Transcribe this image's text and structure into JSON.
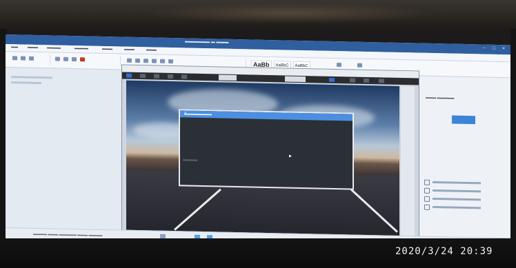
{
  "office": {
    "style_gallery": [
      "AaBb",
      "AaBbC",
      "AaBbC"
    ]
  },
  "timestamp": "2020/3/24  20:39",
  "icons": {
    "close": "close-icon",
    "cursor": "cursor-icon",
    "checkbox": "checkbox-icon"
  },
  "colors": {
    "title_bar": "#2f5f9e",
    "accent_button": "#3b84d8",
    "dialog_bar": "#4c8fe0",
    "dialog_body": "#2b2f36"
  }
}
